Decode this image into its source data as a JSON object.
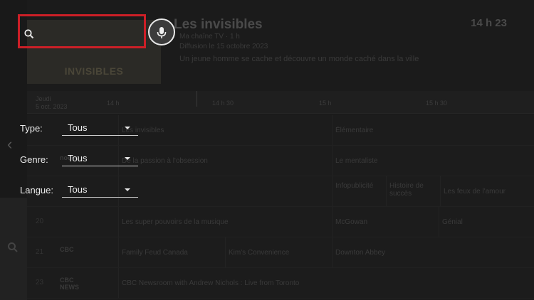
{
  "search": {
    "icon": "search-icon",
    "value": ""
  },
  "mic": {
    "icon": "microphone-icon"
  },
  "filters": [
    {
      "label": "Type:",
      "value": "Tous"
    },
    {
      "label": "Genre:",
      "value": "Tous"
    },
    {
      "label": "Langue:",
      "value": "Tous"
    }
  ],
  "background": {
    "poster_title": "INVISIBLES",
    "show_title": "Les invisibles",
    "show_meta1": "Ma chaîne TV · 1 h",
    "show_meta2": "Diffusion le 15 octobre 2023",
    "show_desc": "Un jeune homme se cache et découvre un monde caché dans la ville",
    "clock": "14 h 23",
    "date_line1": "Jeudi",
    "date_line2": "5 oct. 2023",
    "times": [
      "14 h",
      "14 h 30",
      "15 h",
      "15 h 30"
    ],
    "rows": [
      {
        "num": "",
        "logo": "",
        "programs": [
          "Les invisibles",
          "Élémentaire"
        ]
      },
      {
        "num": "",
        "logo": "noovo",
        "programs": [
          "De la passion à l'obsession",
          "Le mentaliste"
        ]
      },
      {
        "num": "",
        "logo": "",
        "programs": [
          "",
          "Infopublicité",
          "Histoire de succès",
          "Les feux de l'amour"
        ]
      },
      {
        "num": "20",
        "logo": "",
        "programs": [
          "Les super pouvoirs de la musique",
          "McGowan",
          "Génial"
        ]
      },
      {
        "num": "21",
        "logo": "CBC",
        "programs": [
          "Family Feud Canada",
          "Kim's Convenience",
          "Downton Abbey"
        ]
      },
      {
        "num": "23",
        "logo": "CBC NEWS",
        "programs": [
          "CBC Newsroom with Andrew Nichols : Live from Toronto"
        ]
      }
    ]
  },
  "colors": {
    "accent": "#cc1f27",
    "overlay_bg": "#151515"
  }
}
